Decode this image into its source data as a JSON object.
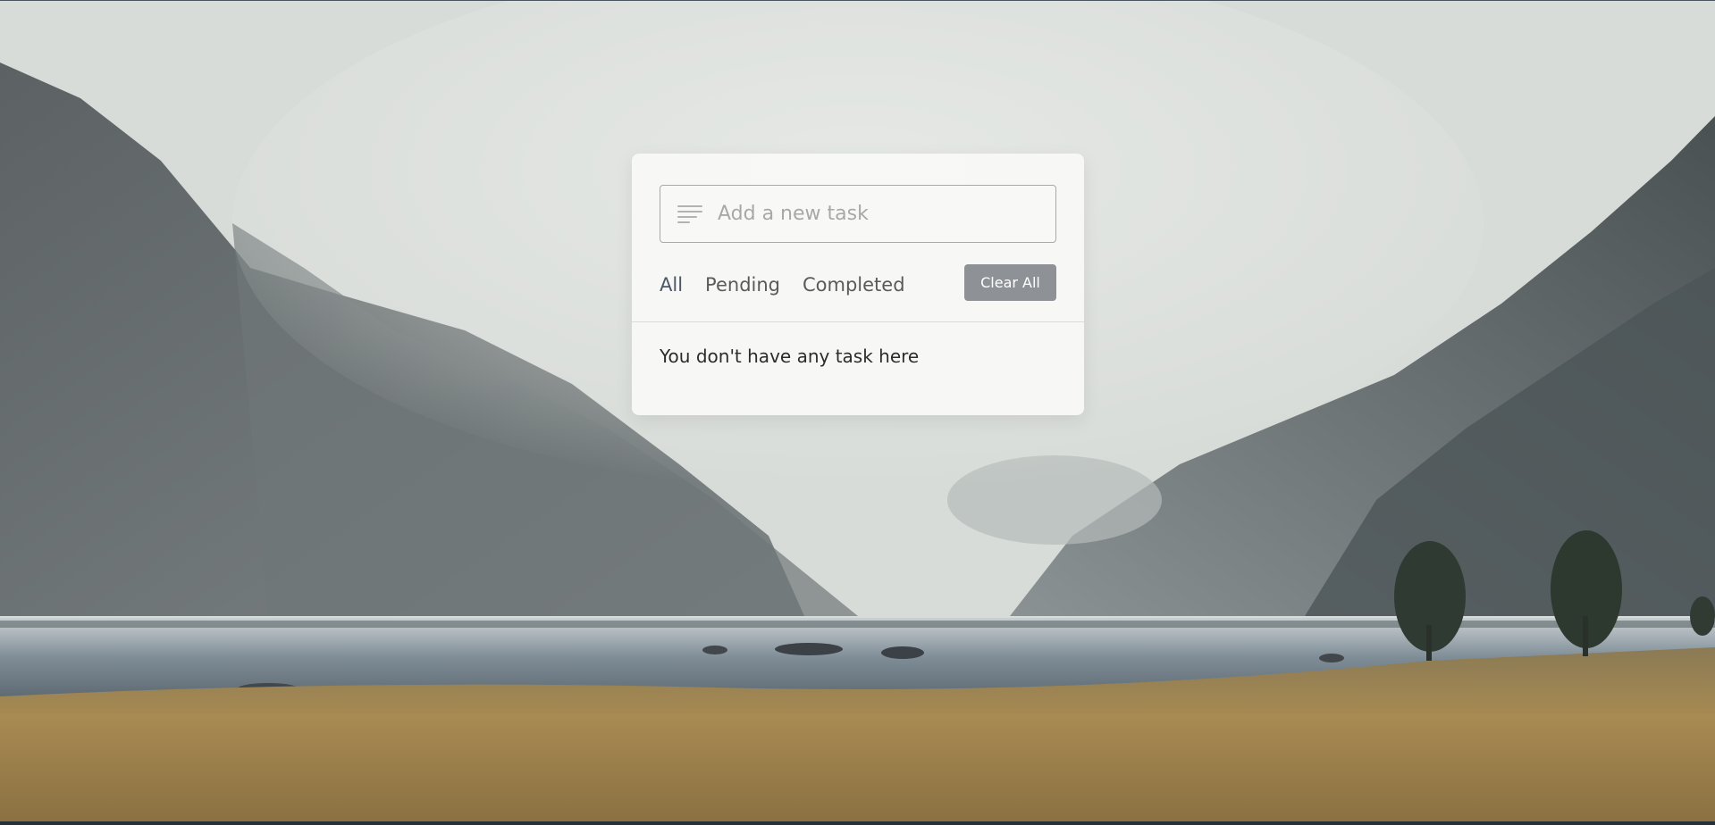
{
  "todo": {
    "input": {
      "placeholder": "Add a new task",
      "value": ""
    },
    "filters": [
      {
        "label": "All",
        "active": true
      },
      {
        "label": "Pending",
        "active": false
      },
      {
        "label": "Completed",
        "active": false
      }
    ],
    "clear_label": "Clear All",
    "empty_message": "You don't have any task here"
  },
  "icons": {
    "input_icon": "text-lines-icon"
  },
  "colors": {
    "clear_button": "#8e9297",
    "active_filter": "#4a5766",
    "card_bg": "#f8f8f7"
  }
}
